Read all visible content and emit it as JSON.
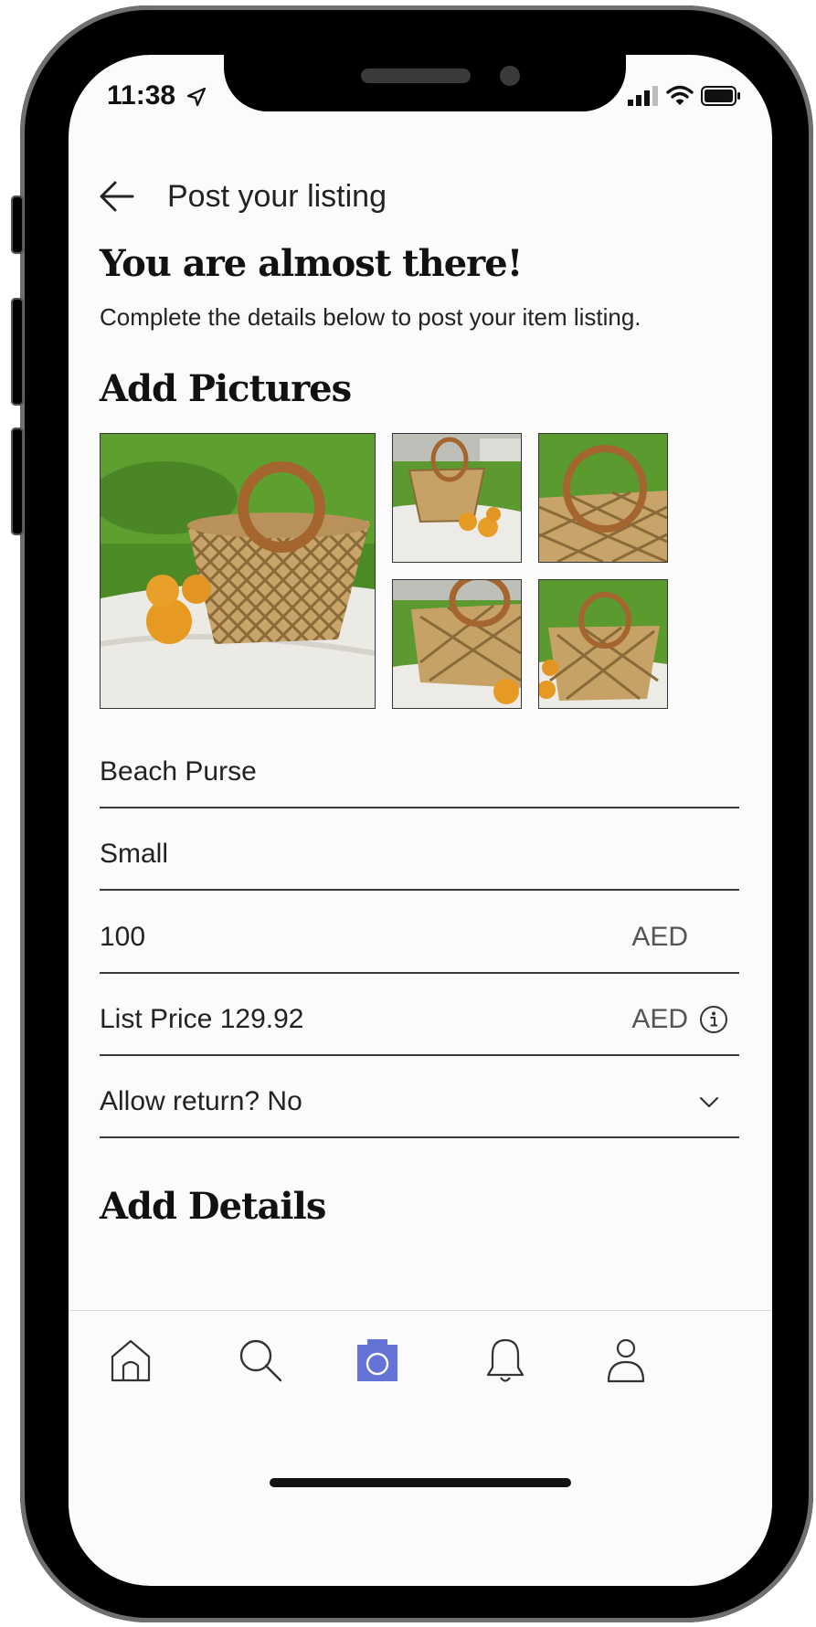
{
  "status_bar": {
    "time": "11:38"
  },
  "header": {
    "title": "Post your listing"
  },
  "intro": {
    "headline": "You are almost there!",
    "subtitle": "Complete the details below to post your item listing."
  },
  "pictures": {
    "section_title": "Add Pictures"
  },
  "form": {
    "item_name": "Beach Purse",
    "size": "Small",
    "price": {
      "value": "100",
      "currency": "AED"
    },
    "list_price": {
      "label": "List Price 129.92",
      "currency": "AED"
    },
    "allow_return": "Allow return? No"
  },
  "details": {
    "section_title": "Add Details"
  },
  "tab_bar": {
    "accent_color": "#6673d6",
    "tabs": [
      "home-icon",
      "search-icon",
      "camera-icon",
      "bell-icon",
      "profile-icon"
    ]
  }
}
